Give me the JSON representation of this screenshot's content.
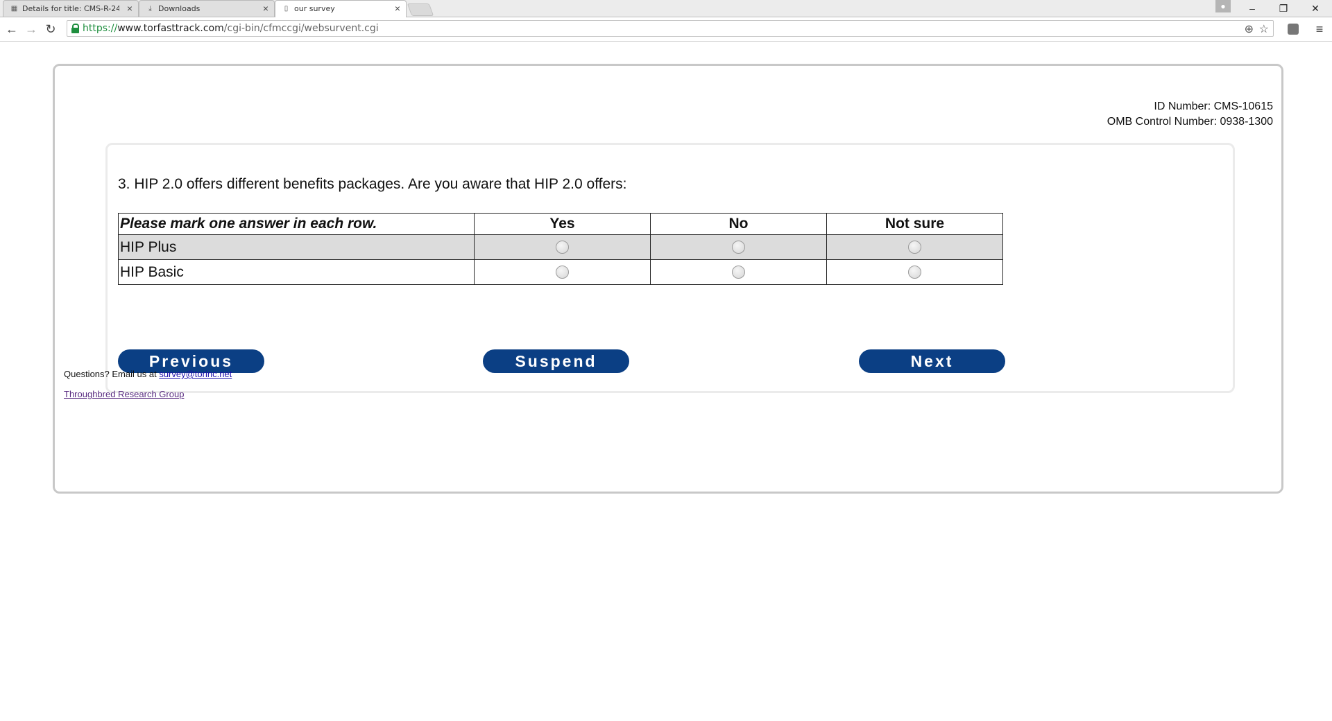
{
  "browser": {
    "tabs": [
      {
        "title": "Details for title: CMS-R-24",
        "icon": "cms-favicon"
      },
      {
        "title": "Downloads",
        "icon": "download-icon"
      },
      {
        "title": "our survey",
        "icon": "page-icon"
      }
    ],
    "url": {
      "scheme": "https://",
      "host": "www.torfasttrack.com",
      "path": "/cgi-bin/cfmccgi/websurvent.cgi"
    }
  },
  "header": {
    "id_number": "ID Number: CMS-10615",
    "omb_number": "OMB Control Number: 0938-1300"
  },
  "question": {
    "text": "3. HIP 2.0 offers different benefits packages. Are you aware that HIP 2.0 offers:",
    "instruction": "Please mark one answer in each row.",
    "columns": [
      "Yes",
      "No",
      "Not sure"
    ],
    "rows": [
      "HIP Plus",
      "HIP Basic"
    ]
  },
  "buttons": {
    "previous": "Previous",
    "suspend": "Suspend",
    "next": "Next"
  },
  "footer": {
    "questions_text": "Questions? Email us at",
    "email": "survey@torinc.net",
    "org": "Throughbred Research Group"
  },
  "colors": {
    "button_bg": "#0b3f84",
    "row_shade": "#dcdcdc"
  }
}
